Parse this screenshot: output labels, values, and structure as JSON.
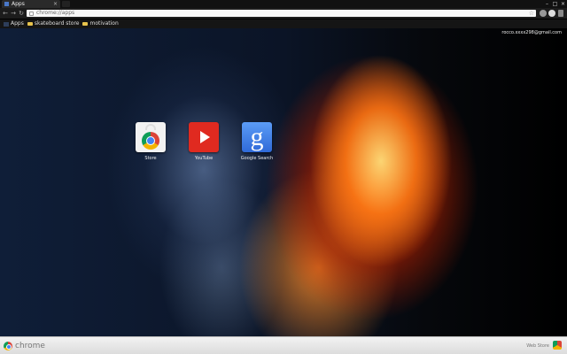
{
  "tab": {
    "title": "Apps",
    "close_glyph": "×",
    "favicon": "apps-icon"
  },
  "window_controls": {
    "minimize": "–",
    "maximize": "□",
    "close": "×"
  },
  "toolbar": {
    "back": "←",
    "forward": "→",
    "reload": "↻",
    "url": "chrome://apps",
    "star": "☆"
  },
  "bookmarks": [
    {
      "label": "Apps",
      "icon": "apps-icon"
    },
    {
      "label": "skateboard store",
      "icon": "folder-icon"
    },
    {
      "label": "motivation",
      "icon": "folder-icon"
    }
  ],
  "user": {
    "email": "rocco.xxxx298@gmail.com"
  },
  "apps": [
    {
      "label": "Store",
      "icon": "chrome-web-store-icon"
    },
    {
      "label": "YouTube",
      "icon": "youtube-icon"
    },
    {
      "label": "Google Search",
      "icon": "google-search-icon",
      "glyph": "g"
    }
  ],
  "bottom_bar": {
    "brand": "chrome",
    "webstore_label": "Web Store"
  },
  "colors": {
    "youtube_red": "#e02a20",
    "google_blue": "#2f6ad8",
    "fire_orange": "#ff7a1a",
    "water_blue": "#0f1e38"
  }
}
